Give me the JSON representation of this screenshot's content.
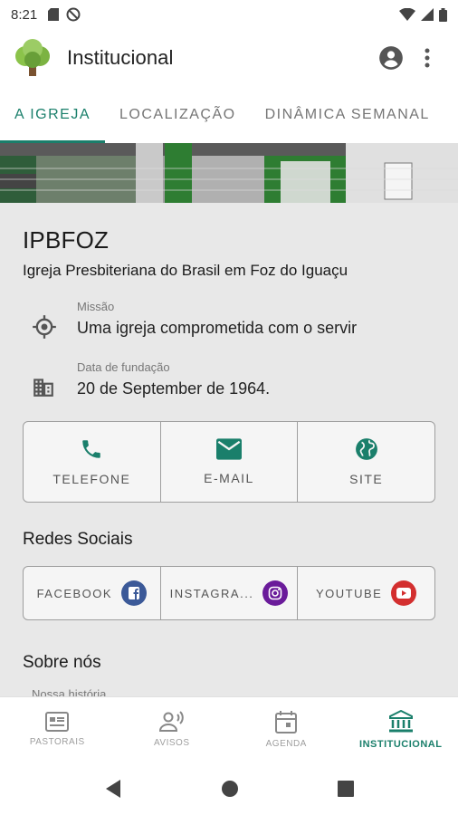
{
  "status_bar": {
    "time": "8:21"
  },
  "app_bar": {
    "title": "Institucional"
  },
  "tabs": [
    {
      "label": "A IGREJA",
      "active": true
    },
    {
      "label": "LOCALIZAÇÃO",
      "active": false
    },
    {
      "label": "DINÂMICA SEMANAL",
      "active": false
    }
  ],
  "church": {
    "name": "IPBFOZ",
    "full_name": "Igreja Presbiteriana do Brasil em Foz do Iguaçu"
  },
  "info": [
    {
      "label": "Missão",
      "value": "Uma igreja comprometida com o servir",
      "icon": "target-icon"
    },
    {
      "label": "Data de fundação",
      "value": "20 de September de 1964.",
      "icon": "building-icon"
    }
  ],
  "contacts": [
    {
      "label": "TELEFONE",
      "icon": "phone-icon"
    },
    {
      "label": "E-MAIL",
      "icon": "mail-icon"
    },
    {
      "label": "SITE",
      "icon": "globe-icon"
    }
  ],
  "social_title": "Redes Sociais",
  "social": [
    {
      "label": "FACEBOOK",
      "icon": "facebook-icon",
      "color": "#3b5998"
    },
    {
      "label": "INSTAGRA...",
      "icon": "instagram-icon",
      "color": "#6a1b9a"
    },
    {
      "label": "YOUTUBE",
      "icon": "youtube-icon",
      "color": "#d32f2f"
    }
  ],
  "about": {
    "title": "Sobre nós",
    "subtitle": "Nossa história"
  },
  "bottom_nav": [
    {
      "label": "PASTORAIS",
      "icon": "newspaper-icon",
      "active": false
    },
    {
      "label": "AVISOS",
      "icon": "announcement-icon",
      "active": false
    },
    {
      "label": "AGENDA",
      "icon": "calendar-icon",
      "active": false
    },
    {
      "label": "INSTITUCIONAL",
      "icon": "institution-icon",
      "active": true
    }
  ],
  "colors": {
    "accent": "#1a7f6b",
    "content_bg": "#e8e8e8"
  }
}
